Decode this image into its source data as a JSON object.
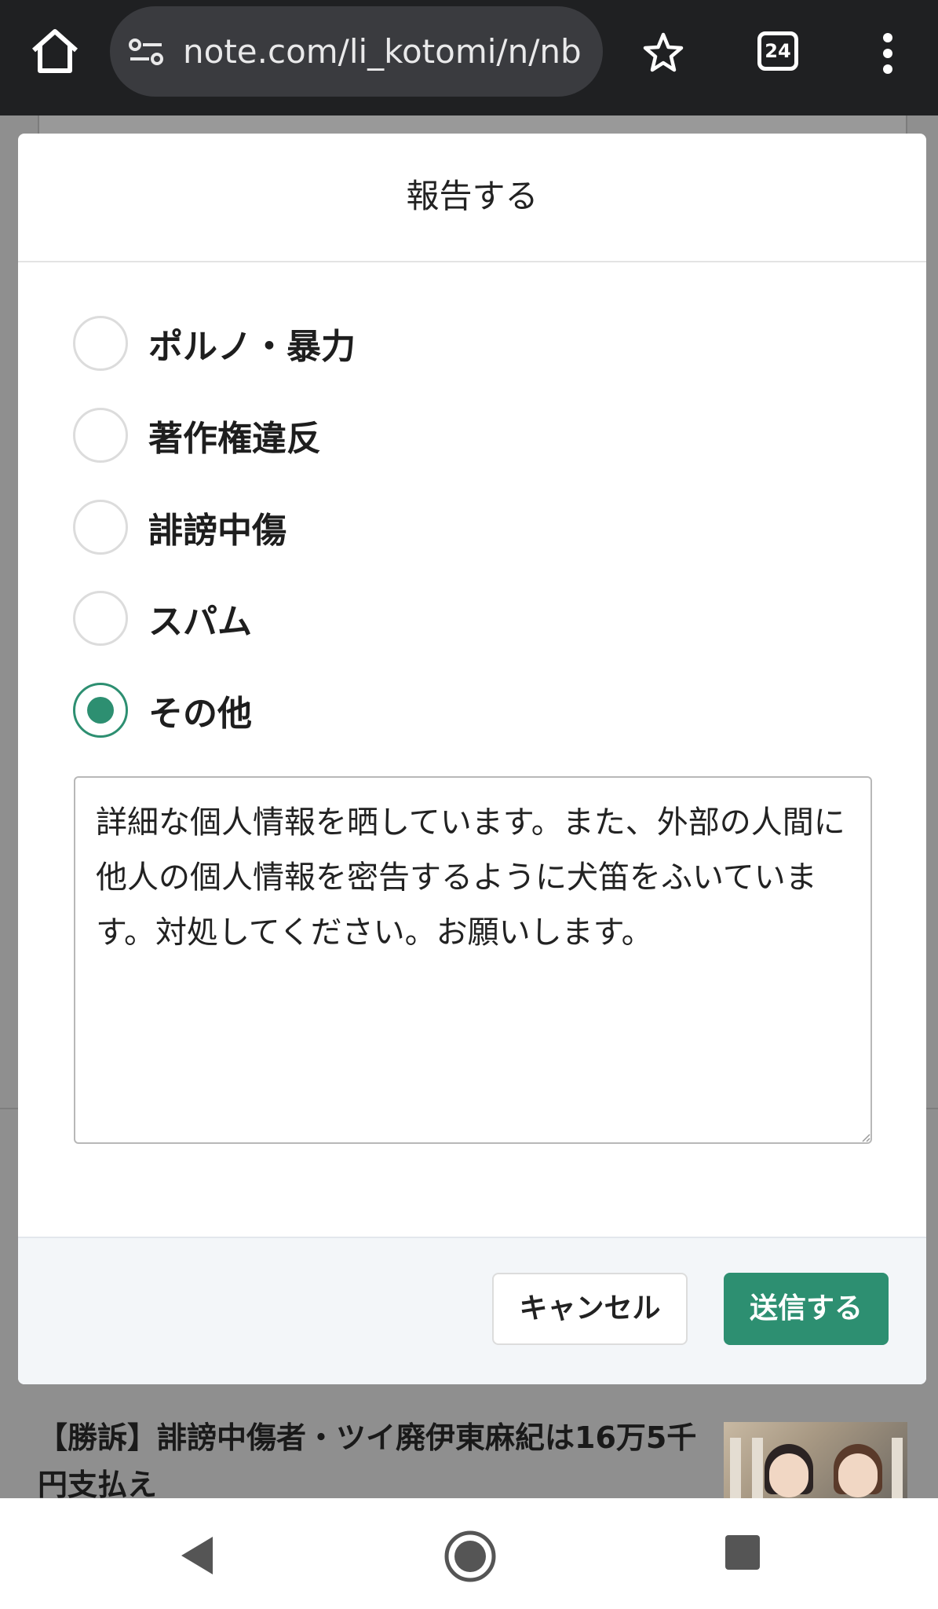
{
  "browser": {
    "url": "note.com/li_kotomi/n/nb",
    "tab_count": "24"
  },
  "modal": {
    "title": "報告する",
    "options": [
      {
        "label": "ポルノ・暴力",
        "checked": false
      },
      {
        "label": "著作権違反",
        "checked": false
      },
      {
        "label": "誹謗中傷",
        "checked": false
      },
      {
        "label": "スパム",
        "checked": false
      },
      {
        "label": "その他",
        "checked": true
      }
    ],
    "detail_text": "詳細な個人情報を晒しています。また、外部の人間に他人の個人情報を密告するように犬笛をふいています。対処してください。お願いします。",
    "cancel_label": "キャンセル",
    "submit_label": "送信する"
  },
  "background_article": {
    "title": "【勝訴】誹謗中傷者・ツイ廃伊東麻紀は16万5千円支払え"
  },
  "colors": {
    "accent": "#2d8f71",
    "topbar": "#1f2022"
  }
}
